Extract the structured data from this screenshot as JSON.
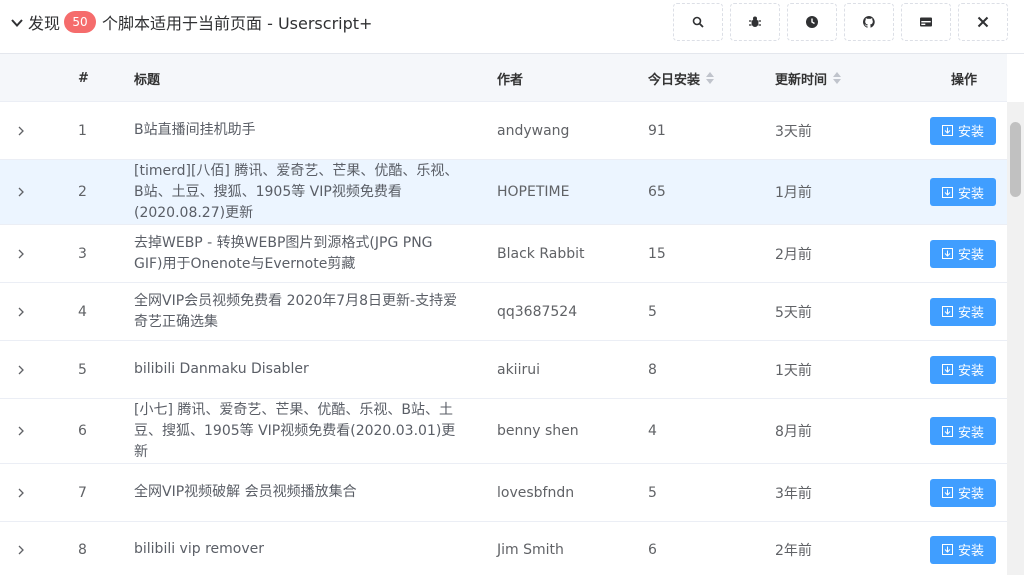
{
  "header": {
    "title_prefix": "发现",
    "count": "50",
    "title_suffix": "个脚本适用于当前页面 - Userscript+",
    "tools": [
      "search-icon",
      "bug-icon",
      "history-icon",
      "github-icon",
      "panel-icon",
      "close-icon"
    ]
  },
  "table": {
    "columns": {
      "num": "#",
      "title": "标题",
      "author": "作者",
      "installs": "今日安装",
      "updated": "更新时间",
      "action": "操作"
    },
    "install_label": "安装",
    "rows": [
      {
        "num": "1",
        "title": "B站直播间挂机助手",
        "author": "andywang",
        "installs": "91",
        "updated": "3天前"
      },
      {
        "num": "2",
        "title": "[timerd][八佰] 腾讯、爱奇艺、芒果、优酷、乐视、B站、土豆、搜狐、1905等 VIP视频免费看(2020.08.27)更新",
        "author": "HOPETIME",
        "installs": "65",
        "updated": "1月前"
      },
      {
        "num": "3",
        "title": "去掉WEBP - 转换WEBP图片到源格式(JPG PNG GIF)用于Onenote与Evernote剪藏",
        "author": "Black Rabbit",
        "installs": "15",
        "updated": "2月前"
      },
      {
        "num": "4",
        "title": "全网VIP会员视频免费看 2020年7月8日更新-支持爱奇艺正确选集",
        "author": "qq3687524",
        "installs": "5",
        "updated": "5天前"
      },
      {
        "num": "5",
        "title": "bilibili Danmaku Disabler",
        "author": "akiirui",
        "installs": "8",
        "updated": "1天前"
      },
      {
        "num": "6",
        "title": "[小七] 腾讯、爱奇艺、芒果、优酷、乐视、B站、土豆、搜狐、1905等 VIP视频免费看(2020.03.01)更新",
        "author": "benny shen",
        "installs": "4",
        "updated": "8月前"
      },
      {
        "num": "7",
        "title": "全网VIP视频破解 会员视频播放集合",
        "author": "lovesbfndn",
        "installs": "5",
        "updated": "3年前"
      },
      {
        "num": "8",
        "title": "bilibili vip remover",
        "author": "Jim Smith",
        "installs": "6",
        "updated": "2年前"
      }
    ]
  }
}
